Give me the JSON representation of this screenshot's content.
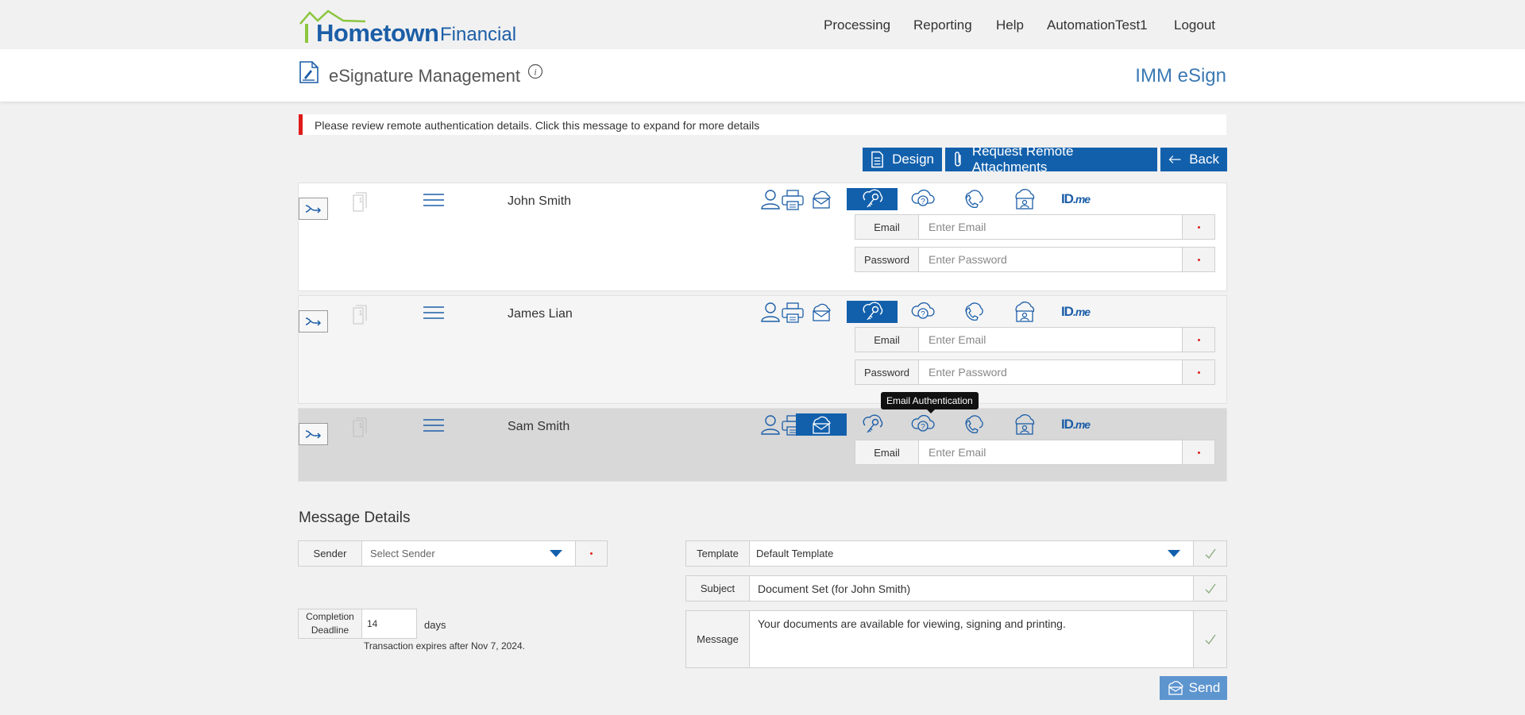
{
  "brand": {
    "name_bold": "Hometown",
    "name_light": "Financial"
  },
  "nav": {
    "items": [
      "Processing",
      "Reporting",
      "Help",
      "AutomationTest1",
      "Logout"
    ]
  },
  "header": {
    "page_title": "eSignature Management",
    "app_title": "IMM eSign"
  },
  "alert": {
    "text": "Please review remote authentication details. Click this message to expand for more details"
  },
  "actions": {
    "design": "Design",
    "request_attachments": "Request Remote Attachments",
    "back": "Back"
  },
  "auth_icons": [
    "person-icon",
    "email-cloud-icon",
    "key-cloud-icon",
    "question-cloud-icon",
    "phone-cloud-icon",
    "id-cloud-icon",
    "idme-logo"
  ],
  "idme": {
    "id": "ID",
    "me": ".me"
  },
  "signers": [
    {
      "name": "John Smith",
      "doc_count": "1",
      "selected_auth": "key-cloud-icon",
      "fields": [
        {
          "label": "Email",
          "placeholder": "Enter Email",
          "value": ""
        },
        {
          "label": "Password",
          "placeholder": "Enter Password",
          "value": ""
        }
      ]
    },
    {
      "name": "James Lian",
      "doc_count": "1",
      "selected_auth": "key-cloud-icon",
      "fields": [
        {
          "label": "Email",
          "placeholder": "Enter Email",
          "value": ""
        },
        {
          "label": "Password",
          "placeholder": "Enter Password",
          "value": ""
        }
      ]
    },
    {
      "name": "Sam Smith",
      "doc_count": "1",
      "selected_auth": "email-cloud-icon",
      "fields": [
        {
          "label": "Email",
          "placeholder": "Enter Email",
          "value": ""
        }
      ]
    }
  ],
  "tooltip": "Email Authentication",
  "message_details": {
    "title": "Message Details",
    "sender_label": "Sender",
    "sender_value": "Select Sender",
    "deadline_label": "Completion Deadline",
    "deadline_value": "14",
    "deadline_unit": "days",
    "expire_text": "Transaction expires after Nov 7, 2024.",
    "template_label": "Template",
    "template_value": "Default Template",
    "subject_label": "Subject",
    "subject_value": "Document Set (for John Smith)",
    "message_label": "Message",
    "message_value": "Your documents are available for viewing, signing and printing.",
    "send": "Send"
  },
  "colors": {
    "primary": "#1260ac",
    "brand_green": "#8cc63f",
    "alert_red": "#e01b1b",
    "send_light": "#5d95cf"
  }
}
